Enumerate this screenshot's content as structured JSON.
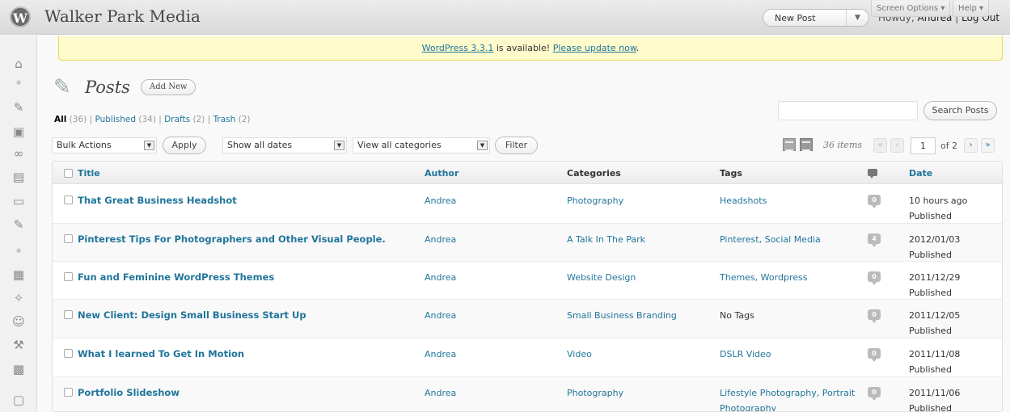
{
  "header": {
    "logo_glyph": "W",
    "site_title": "Walker Park Media",
    "favorite_action": "New Post",
    "favorite_toggle": "▼",
    "howdy": "Howdy,",
    "username": "Andrea",
    "separator": "|",
    "logout": "Log Out"
  },
  "update_nag": {
    "version_link": "WordPress 3.3.1",
    "middle_text": " is available! ",
    "update_link": "Please update now",
    "period": "."
  },
  "screen_meta": {
    "screen_options": "Screen Options ▾",
    "help": "Help ▾"
  },
  "menu_icons": [
    "dashboard-icon",
    "posts-icon",
    "media-icon",
    "links-icon",
    "pages-icon",
    "comments-icon",
    "custom-icon",
    "appearance-icon",
    "plugins-icon",
    "users-icon",
    "tools-icon",
    "settings-icon",
    "extra-icon"
  ],
  "page": {
    "title": "Posts",
    "add_new": "Add New"
  },
  "filters": {
    "all": "All",
    "all_count": "(36)",
    "published": "Published",
    "published_count": "(34)",
    "drafts": "Drafts",
    "drafts_count": "(2)",
    "trash": "Trash",
    "trash_count": "(2)",
    "sep": "|"
  },
  "search": {
    "value": "",
    "button": "Search Posts"
  },
  "tablenav": {
    "bulk_actions": "Bulk Actions",
    "apply": "Apply",
    "dates": "Show all dates",
    "categories": "View all categories",
    "filter": "Filter",
    "items": "36 items",
    "first": "«",
    "prev": "‹",
    "page": "1",
    "of": "of 2",
    "next": "›",
    "last": "»",
    "arrow": "▼"
  },
  "columns": {
    "title": "Title",
    "author": "Author",
    "categories": "Categories",
    "tags": "Tags",
    "date": "Date"
  },
  "posts": [
    {
      "title": "That Great Business Headshot",
      "author": "Andrea",
      "categories": "Photography",
      "tags": "Headshots",
      "comments": "0",
      "date": "10 hours ago",
      "status": "Published"
    },
    {
      "title": "Pinterest Tips For Photographers and Other Visual People.",
      "author": "Andrea",
      "categories": "A Talk In The Park",
      "tags": "Pinterest, Social Media",
      "comments": "4",
      "date": "2012/01/03",
      "status": "Published"
    },
    {
      "title": "Fun and Feminine WordPress Themes",
      "author": "Andrea",
      "categories": "Website Design",
      "tags": "Themes, Wordpress",
      "comments": "0",
      "date": "2011/12/29",
      "status": "Published"
    },
    {
      "title": "New Client: Design Small Business Start Up",
      "author": "Andrea",
      "categories": "Small Business Branding",
      "tags": "No Tags",
      "comments": "0",
      "date": "2011/12/05",
      "status": "Published"
    },
    {
      "title": "What I learned To Get In Motion",
      "author": "Andrea",
      "categories": "Video",
      "tags": "DSLR Video",
      "comments": "0",
      "date": "2011/11/08",
      "status": "Published"
    },
    {
      "title": "Portfolio Slideshow",
      "author": "Andrea",
      "categories": "Photography",
      "tags": "Lifestyle Photography, Portrait Photography",
      "comments": "0",
      "date": "2011/11/06",
      "status": "Published"
    }
  ],
  "colors": {
    "link": "#21759b",
    "nag_bg": "#fffbcc",
    "header_bg": "#d9d9d9"
  }
}
